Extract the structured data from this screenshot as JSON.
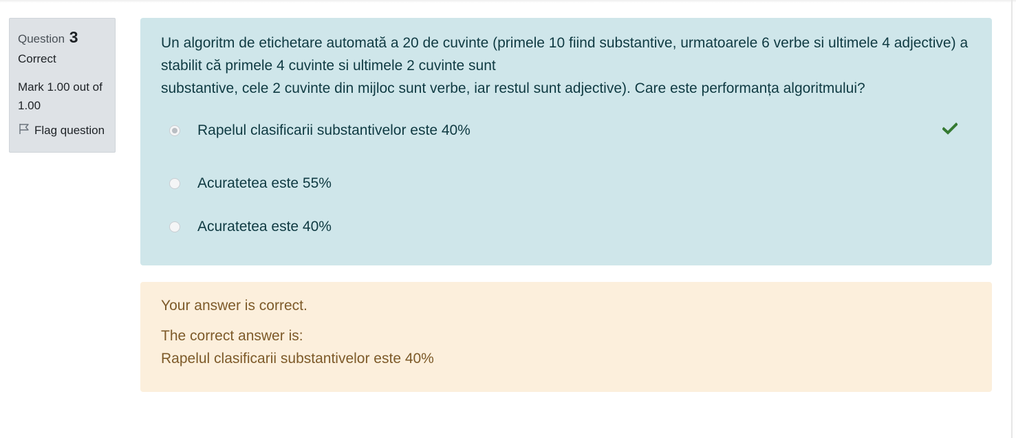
{
  "info": {
    "question_label": "Question",
    "question_number": "3",
    "state": "Correct",
    "grade": "Mark 1.00 out of 1.00",
    "flag_label": "Flag question"
  },
  "question": {
    "text_line1": "Un algoritm de etichetare automată a 20 de cuvinte (primele 10 fiind substantive, urmatoarele 6 verbe si ultimele 4 adjective) a stabilit că primele 4 cuvinte si ultimele 2 cuvinte sunt",
    "text_line2": "substantive, cele 2 cuvinte din mijloc sunt verbe, iar restul sunt adjective). Care este performanța algoritmului?",
    "answers": [
      {
        "label": "Rapelul clasificarii substantivelor este 40%",
        "checked": true,
        "correct": true
      },
      {
        "label": "Acuratetea este 55%",
        "checked": false,
        "correct": false
      },
      {
        "label": "Acuratetea este 40%",
        "checked": false,
        "correct": false
      }
    ],
    "correct_icon": "check-icon"
  },
  "feedback": {
    "general": "Your answer is correct.",
    "right_answer_label": "The correct answer is:",
    "right_answer_value": "Rapelul clasificarii substantivelor este 40%"
  },
  "colors": {
    "info_bg": "#dee2e6",
    "question_bg": "#cfe6ea",
    "feedback_bg": "#fcefdc",
    "correct_green": "#357a32"
  }
}
